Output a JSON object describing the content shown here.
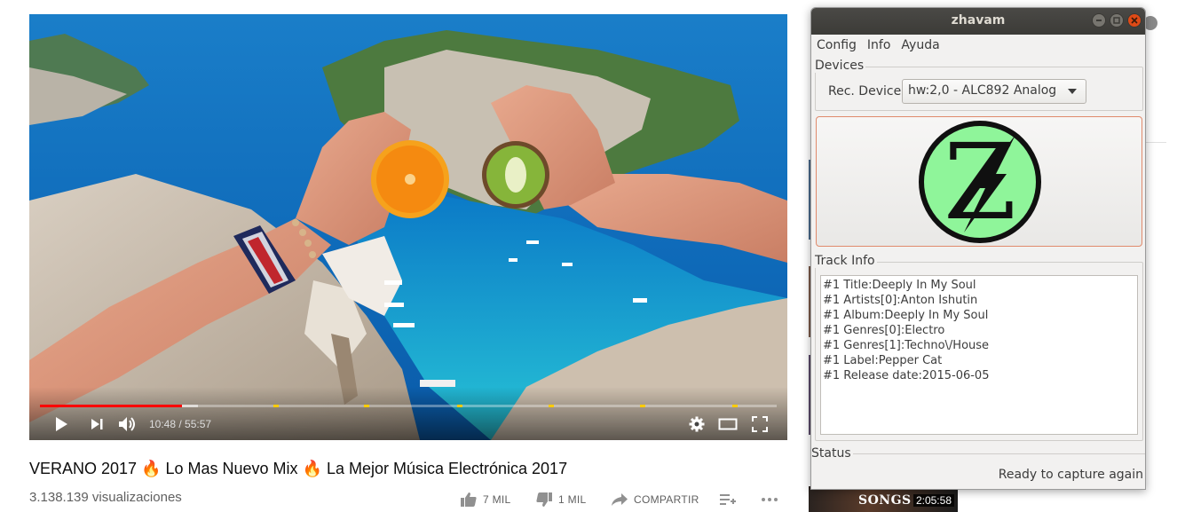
{
  "video": {
    "current_time": "10:48",
    "separator": " / ",
    "duration": "55:57",
    "played_fraction": 0.193,
    "loaded_fraction": 0.215,
    "chapter_markers": [
      0.317,
      0.44,
      0.566,
      0.69,
      0.814,
      0.94
    ],
    "title": "VERANO 2017 🔥 Lo Mas Nuevo Mix 🔥 La Mejor Música Electrónica 2017",
    "views": "3.138.139 visualizaciones",
    "likes": "7 MIL",
    "dislikes": "1 MIL",
    "share_label": "COMPARTIR"
  },
  "sidebar": {
    "thumb_text": "SONGS",
    "thumb_duration": "2:05:58"
  },
  "app": {
    "window_title": "zhavam",
    "menu": [
      "Config",
      "Info",
      "Ayuda"
    ],
    "devices_label": "Devices",
    "rec_device_label": "Rec. Device",
    "rec_device_value": "hw:2,0 - ALC892 Analog",
    "logo_letter": "Z",
    "logo_color": "#8ff59a",
    "track_info_label": "Track Info",
    "track_info_lines": [
      "#1 Title:Deeply In My Soul",
      "#1 Artists[0]:Anton Ishutin",
      "#1 Album:Deeply In My Soul",
      "#1 Genres[0]:Electro",
      "#1 Genres[1]:Techno\\/House",
      "#1 Label:Pepper Cat",
      "#1 Release date:2015-06-05"
    ],
    "status_label": "Status",
    "status_text": "Ready to capture again"
  },
  "colors": {
    "progress_played": "#ff0000",
    "chapter_marker": "#ffcc00",
    "titlebar": "#3c3b37",
    "close_button": "#df4a16"
  }
}
